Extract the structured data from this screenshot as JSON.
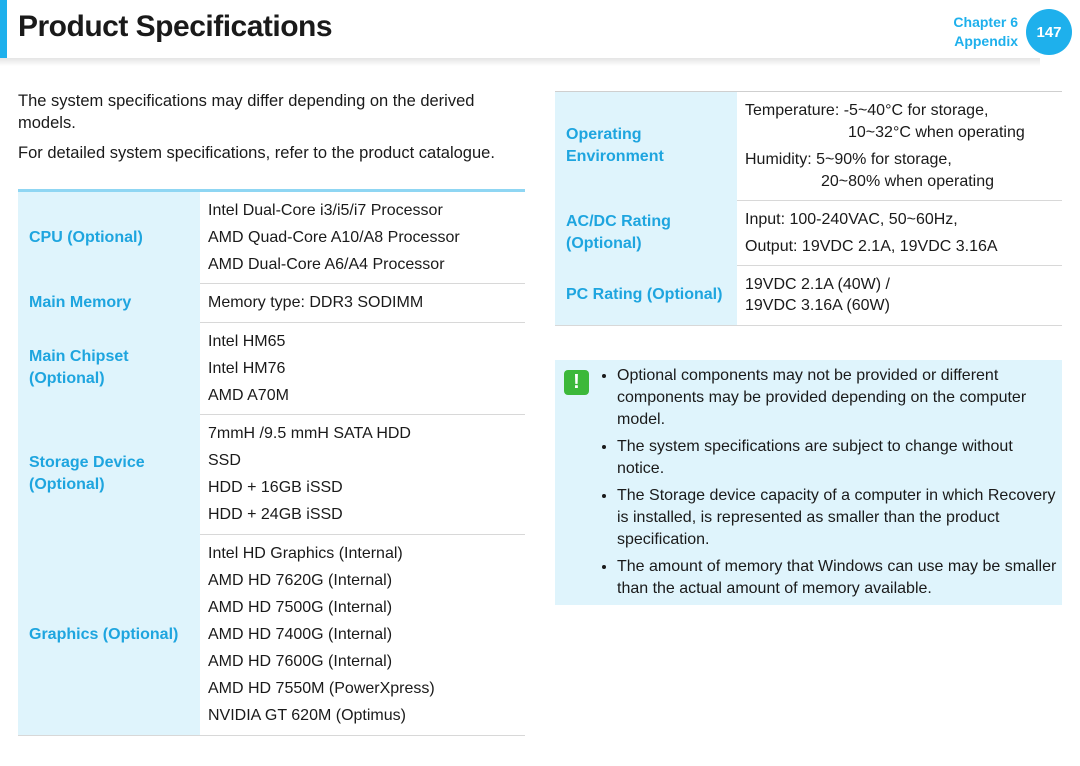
{
  "header": {
    "title": "Product Specifications",
    "chapter": "Chapter 6",
    "section": "Appendix",
    "page": "147"
  },
  "intro": [
    "The system specifications may differ depending on the derived models.",
    "For detailed system specifications, refer to the product catalogue."
  ],
  "left_table": [
    {
      "label": [
        "CPU (Optional)"
      ],
      "values": [
        "Intel Dual-Core i3/i5/i7 Processor",
        "AMD Quad-Core A10/A8 Processor",
        "AMD Dual-Core A6/A4 Processor"
      ]
    },
    {
      "label": [
        "Main Memory"
      ],
      "values": [
        "Memory type: DDR3 SODIMM"
      ]
    },
    {
      "label": [
        "Main Chipset",
        "(Optional)"
      ],
      "values": [
        "Intel HM65",
        "Intel HM76",
        "AMD A70M"
      ]
    },
    {
      "label": [
        "Storage Device",
        "(Optional)"
      ],
      "values": [
        "7mmH /9.5 mmH SATA HDD",
        "SSD",
        "HDD +  16GB iSSD",
        "HDD +  24GB iSSD"
      ]
    },
    {
      "label": [
        "Graphics (Optional)"
      ],
      "values": [
        "Intel HD Graphics (Internal)",
        "AMD HD 7620G (Internal)",
        "AMD HD 7500G (Internal)",
        "AMD HD 7400G (Internal)",
        "AMD HD 7600G (Internal)",
        "AMD HD 7550M (PowerXpress)",
        "NVIDIA GT 620M (Optimus)"
      ]
    }
  ],
  "right_table": [
    {
      "label": [
        "Operating",
        "Environment"
      ],
      "values": [
        "Temperature: -5~40°C for storage,",
        "10~32°C when operating",
        "Humidity: 5~90% for storage,",
        "20~80% when operating"
      ]
    },
    {
      "label": [
        "AC/DC Rating",
        "(Optional)"
      ],
      "values": [
        "Input: 100-240VAC, 50~60Hz,",
        "Output: 19VDC 2.1A, 19VDC 3.16A"
      ]
    },
    {
      "label": [
        "PC Rating (Optional)"
      ],
      "values": [
        "19VDC 2.1A (40W) /",
        "19VDC 3.16A (60W)"
      ]
    }
  ],
  "notes": {
    "icon": "warning-icon",
    "items": [
      "Optional components may not be provided or different components may be provided depending on the computer model.",
      "The system specifications are subject to change without notice.",
      "The Storage device capacity of a computer in which Recovery is installed, is represented as smaller than the product specification.",
      "The amount of memory that Windows can use may be smaller than the actual amount of memory available."
    ]
  },
  "colors": {
    "accent": "#1eb0ec",
    "label_bg": "#dff4fc",
    "warning": "#3cb83a"
  }
}
